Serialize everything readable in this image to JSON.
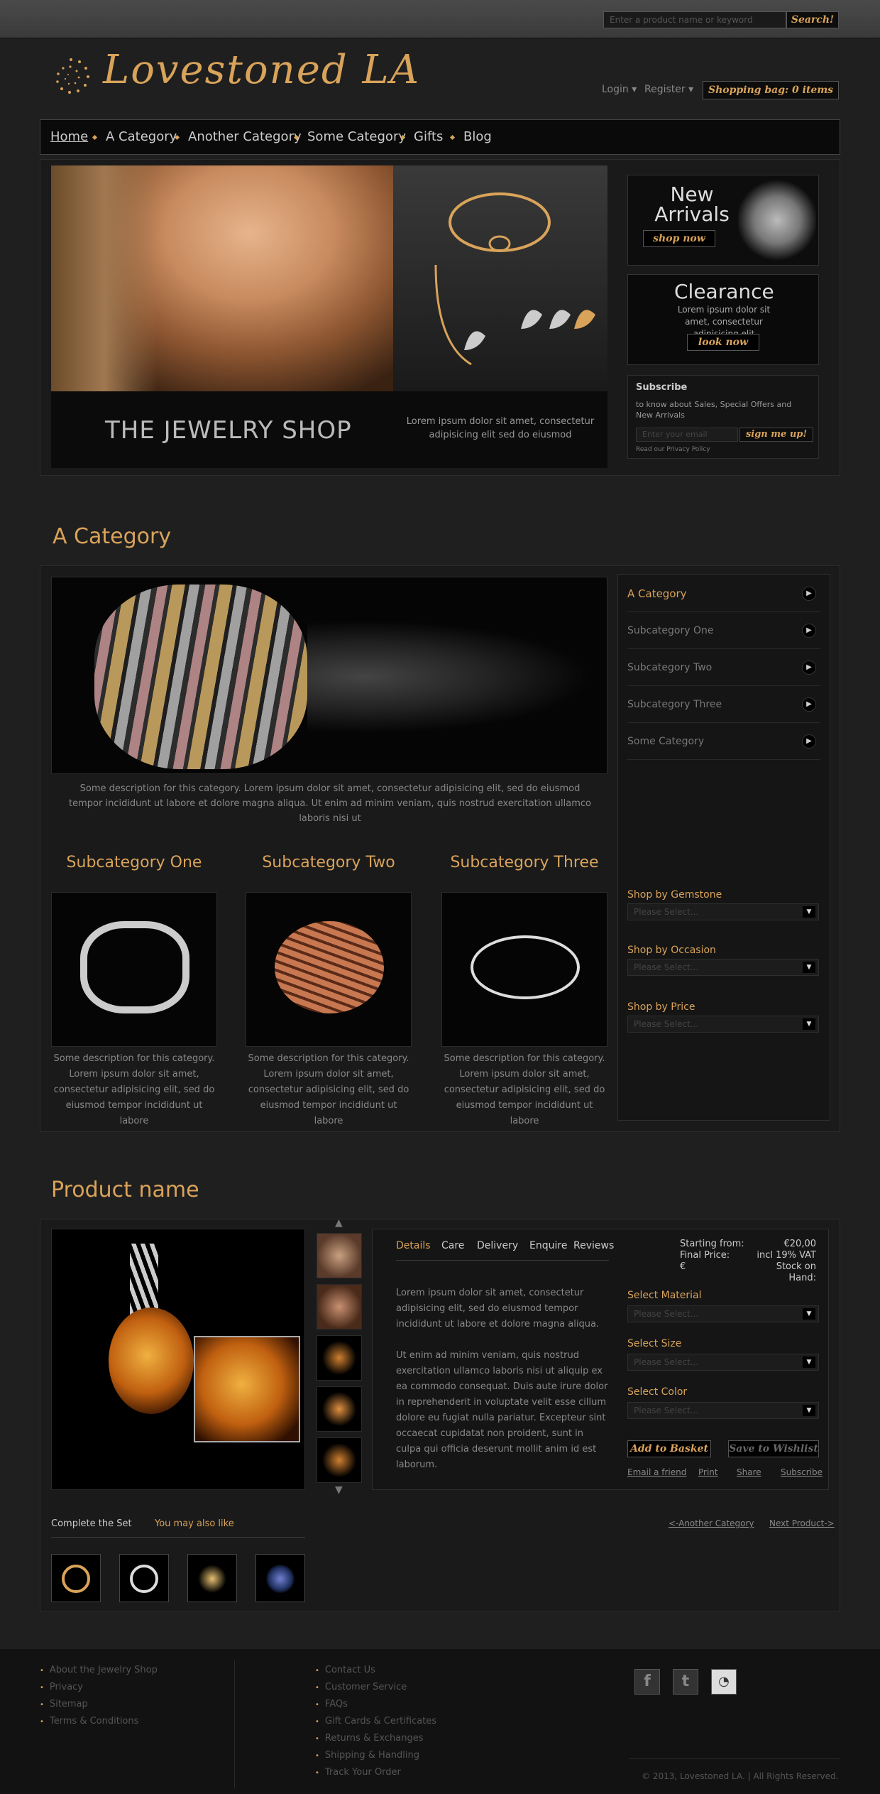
{
  "search": {
    "placeholder": "Enter a product name or keyword",
    "button": "Search!"
  },
  "brand": {
    "name": "Lovestoned LA",
    "accent": "#d9a35a"
  },
  "header": {
    "login": "Login ▾",
    "register": "Register ▾",
    "bag": "Shopping bag: 0 items"
  },
  "nav": {
    "items": [
      "Home",
      "A Category",
      "Another Category",
      "Some Category",
      "Gifts",
      "Blog"
    ],
    "active": "Home"
  },
  "hero": {
    "title": "THE JEWELRY SHOP",
    "subtitle": "Lorem ipsum dolor sit amet, consectetur adipisicing elit sed do eiusmod"
  },
  "promos": {
    "new_title": "New Arrivals",
    "shop_now": "shop now",
    "clearance_title": "Clearance",
    "clearance_text": "Lorem ipsum dolor sit amet, consectetur adipisicing elit",
    "look_now": "look now"
  },
  "subscribe": {
    "title": "Subscribe",
    "text": "to know about Sales, Special Offers and New Arrivals",
    "placeholder": "Enter your email",
    "button": "sign me up!",
    "privacy": "Read our Privacy Policy"
  },
  "category": {
    "heading": "A Category",
    "description": "Some description for this category. Lorem ipsum dolor sit amet, consectetur adipisicing elit, sed do eiusmod tempor incididunt ut labore et dolore magna aliqua. Ut enim ad minim veniam, quis nostrud exercitation ullamco laboris nisi ut",
    "subcategories": [
      {
        "title": "Subcategory One",
        "desc": "Some description for this category. Lorem ipsum dolor sit amet, consectetur adipisicing elit, sed do eiusmod tempor incididunt ut labore"
      },
      {
        "title": "Subcategory Two",
        "desc": "Some description for this category. Lorem ipsum dolor sit amet, consectetur adipisicing elit, sed do eiusmod tempor incididunt ut labore"
      },
      {
        "title": "Subcategory Three",
        "desc": "Some description for this category. Lorem ipsum dolor sit amet, consectetur adipisicing elit, sed do eiusmod tempor incididunt ut labore"
      }
    ],
    "side_menu": [
      "A Category",
      "Subcategory One",
      "Subcategory Two",
      "Subcategory Three",
      "Some Category"
    ],
    "filters": [
      {
        "label": "Shop by Gemstone",
        "placeholder": "Please Select..."
      },
      {
        "label": "Shop by Occasion",
        "placeholder": "Please Select..."
      },
      {
        "label": "Shop by Price",
        "placeholder": "Please Select..."
      }
    ]
  },
  "product": {
    "heading_a": "Product",
    "heading_b": "name",
    "tabs": [
      "Details",
      "Care",
      "Delivery",
      "Enquire",
      "Reviews"
    ],
    "text1": "Lorem ipsum dolor sit amet, consectetur adipisicing elit, sed do eiusmod tempor incididunt ut labore et dolore magna aliqua.",
    "text2": "Ut enim ad minim veniam, quis nostrud exercitation ullamco laboris nisi ut aliquip ex ea commodo consequat. Duis aute irure dolor in reprehenderit in voluptate velit esse cillum dolore eu fugiat nulla pariatur. Excepteur sint occaecat cupidatat non proident, sunt in culpa qui officia deserunt mollit anim id est laborum.",
    "starting_from_label": "Starting from:",
    "starting_from_value": "€20,00",
    "final_price_label": "Final Price:",
    "final_price_value": "incl 19% VAT",
    "euro": "€",
    "stock_label": "Stock on Hand:",
    "options": [
      {
        "label": "Select Material",
        "placeholder": "Please Select..."
      },
      {
        "label": "Select Size",
        "placeholder": "Please Select..."
      },
      {
        "label": "Select Color",
        "placeholder": "Please Select..."
      }
    ],
    "add_basket": "Add to Basket",
    "save_wishlist": "Save to Wishlist",
    "links": [
      "Email a friend",
      "Print",
      "Share",
      "Subscribe"
    ],
    "complete_set": "Complete the Set",
    "you_may_like": "You may also like",
    "prev": "<-Another Category",
    "next": "Next Product->"
  },
  "footer": {
    "col1": [
      "About the Jewelry Shop",
      "Privacy",
      "Sitemap",
      "Terms & Conditions"
    ],
    "col2": [
      "Contact Us",
      "Customer Service",
      "FAQs",
      "Gift Cards & Certificates",
      "Returns & Exchanges",
      "Shipping & Handling",
      "Track Your Order"
    ],
    "social": [
      "facebook-icon",
      "twitter-icon",
      "rss-icon"
    ],
    "copyright": "© 2013, Lovestoned LA. | All Rights Reserved."
  }
}
